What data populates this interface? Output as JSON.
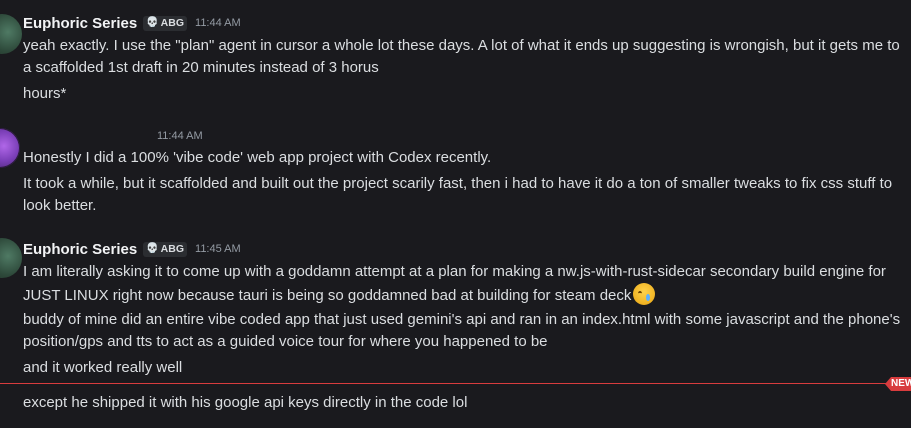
{
  "messages": [
    {
      "username": "Euphoric Series",
      "tag": "ABG",
      "time": "11:44 AM",
      "lines": [
        "yeah exactly. I use the \"plan\" agent  in cursor a whole lot these days. A lot of what it ends up suggesting is wrongish, but it gets me to a scaffolded 1st draft in 20 minutes instead of 3 horus",
        "hours*"
      ]
    },
    {
      "username": "",
      "time": "11:44 AM",
      "lines": [
        "Honestly I did a 100% 'vibe code' web app project with Codex recently.",
        "It took a while, but it scaffolded and built out the project scarily fast, then i had to have it do a ton of smaller tweaks to fix css stuff to look better."
      ]
    },
    {
      "username": "Euphoric Series",
      "tag": "ABG",
      "time": "11:45 AM",
      "lines": [
        "I am literally asking it to come up with a goddamn attempt at a plan for making a nw.js-with-rust-sidecar secondary build engine for JUST LINUX right now because tauri is being so goddamned bad at building for steam deck",
        "buddy of mine did an entire vibe coded app that just used gemini's api and ran in an index.html with some javascript and the phone's position/gps and tts to act as a guided voice tour for where you happened to be",
        "and it worked really well",
        "except he shipped it with his google api keys directly in the code lol"
      ]
    }
  ],
  "divider": {
    "label": "NEW"
  },
  "colors": {
    "background": "#1a1a1e",
    "text": "#dbdee1",
    "username": "#f2f3f5",
    "timestamp": "#949ba4",
    "divider": "#d83c3e",
    "tag_icon": "#f47fff"
  },
  "icons": {
    "tag_icon": "skull-icon",
    "emoji": "crying-face-emoji"
  }
}
